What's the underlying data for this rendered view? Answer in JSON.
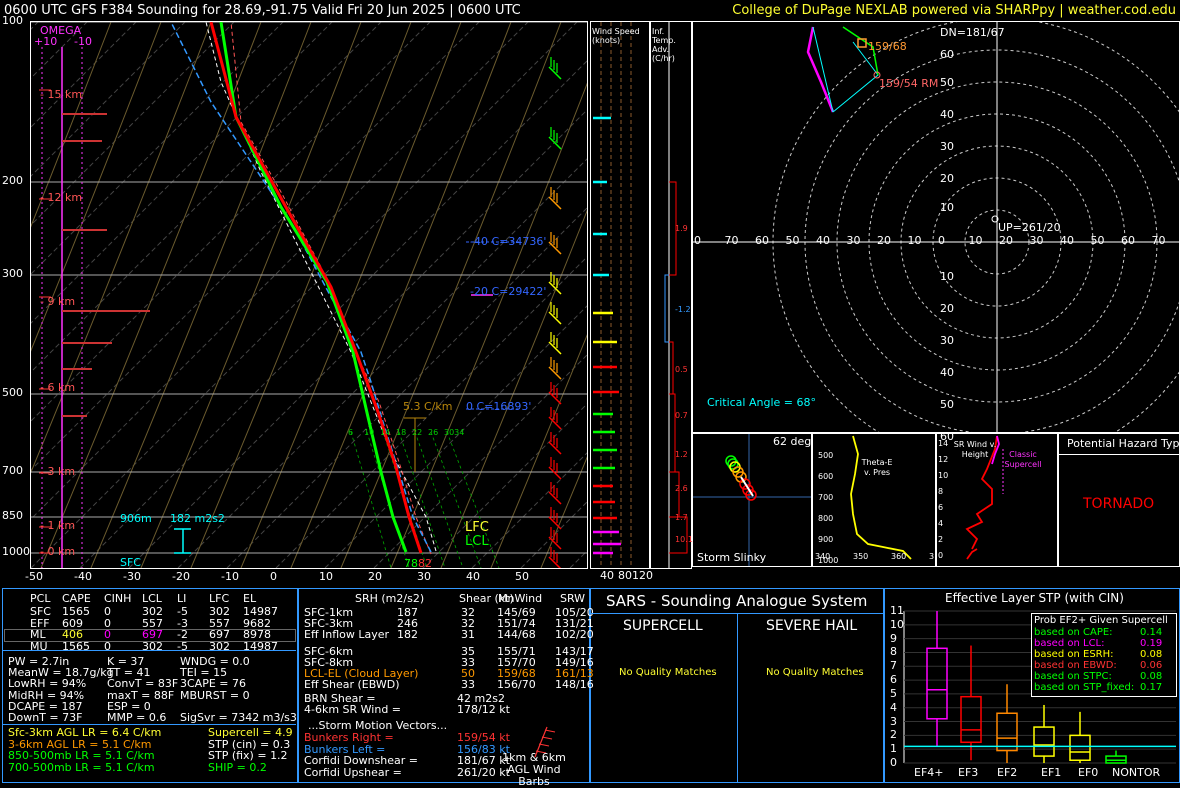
{
  "header": {
    "title": "0600 UTC GFS F384 Sounding for 28.69,-91.75 Valid  Fri 20 Jun 2025 | 0600 UTC",
    "credit": "College of DuPage NEXLAB powered via SHARPpy | weather.cod.edu"
  },
  "skewt": {
    "pressure_labels": [
      "100",
      "200",
      "300",
      "500",
      "700",
      "850",
      "1000"
    ],
    "temp_labels": [
      "-50",
      "-40",
      "-30",
      "-20",
      "-10",
      "0",
      "10",
      "20",
      "30",
      "40",
      "50"
    ],
    "height_labels": [
      "15 km",
      "12 km",
      "9 km",
      "6 km",
      "3 km",
      "1 km",
      "0 km"
    ],
    "omega_label": "OMEGA",
    "omega_ticks": [
      "+10",
      "-10"
    ],
    "annotations": {
      "el": "-40 C=34736'",
      "mpl": "-20 C=29422'",
      "frz": "0 C=16893'",
      "lapse": "5.3 C/km",
      "lfc": "LFC",
      "lcl": "LCL",
      "sfc": "SFC",
      "sfc_height": "906m",
      "srh": "182 m2s2",
      "sfc_temp": "78",
      "sfc_dew": "82",
      "wetbulb_ticks": [
        "6",
        "10",
        "14",
        "18",
        "22",
        "26",
        "3034"
      ]
    },
    "colors": {
      "temp": "#ff0000",
      "dew": "#00cc00",
      "virtual": "#ff0000",
      "wetbulb": "#00ffff",
      "parcel": "#ffffff",
      "isobar": "#aaaaaa",
      "isotherm": "#336699"
    }
  },
  "wind_speed_panel": {
    "title": "Wind Speed (knots)",
    "ticks": [
      "40",
      "80",
      "120"
    ]
  },
  "temp_adv_panel": {
    "title": "Inf. Temp. Adv.(C/hr)",
    "values": [
      "1.9",
      "-1.2",
      "0.5",
      "0.7",
      "1.2",
      "2.6",
      "1.7",
      "10.1"
    ]
  },
  "hodograph": {
    "rings_labels": [
      "60",
      "50",
      "40",
      "30",
      "20",
      "10",
      "0",
      "10",
      "20",
      "30",
      "40",
      "50",
      "60"
    ],
    "x_labels": [
      "0",
      "70",
      "60",
      "50",
      "40",
      "30",
      "20",
      "10",
      "0",
      "10",
      "20",
      "30",
      "40",
      "50",
      "60",
      "70"
    ],
    "dn": "DN=181/67",
    "up": "UP=261/20",
    "lm": "159/68",
    "rm": "159/54 RM",
    "critical_angle": "Critical Angle = 68°"
  },
  "storm_slinky": {
    "label": "Storm Slinky",
    "deg": "62 deg"
  },
  "theta_panel": {
    "label": "Theta-E v. Pres",
    "y_ticks": [
      "500",
      "600",
      "700",
      "800",
      "900",
      "1000"
    ],
    "x_ticks": [
      "340",
      "350",
      "360",
      "3"
    ]
  },
  "srwind_panel": {
    "label": "SR Wind v. Height",
    "y_ticks": [
      "14",
      "12",
      "10",
      "8",
      "6",
      "4",
      "2",
      "0"
    ],
    "classic": "Classic Supercell"
  },
  "hazard": {
    "title": "Potential Hazard Type",
    "value": "TORNADO"
  },
  "parcels": {
    "headers": [
      "PCL",
      "CAPE",
      "CINH",
      "LCL",
      "LI",
      "LFC",
      "EL"
    ],
    "rows": [
      [
        "SFC",
        "1565",
        "0",
        "302",
        "-5",
        "302",
        "14987"
      ],
      [
        "EFF",
        "609",
        "0",
        "557",
        "-3",
        "557",
        "9682"
      ],
      [
        "ML",
        "406",
        "0",
        "697",
        "-2",
        "697",
        "8978"
      ],
      [
        "MU",
        "1565",
        "0",
        "302",
        "-5",
        "302",
        "14987"
      ]
    ]
  },
  "indices": {
    "col1": [
      "PW = 2.7in",
      "MeanW = 18.7g/kg",
      "LowRH = 94%",
      "MidRH = 94%",
      "DCAPE = 187",
      "DownT = 73F"
    ],
    "col2": [
      "K = 37",
      "TT = 41",
      "ConvT = 83F",
      "maxT = 88F",
      "ESP = 0",
      "MMP = 0.6"
    ],
    "col3": [
      "WNDG = 0.0",
      "TEI = 15",
      "3CAPE = 76",
      "MBURST = 0",
      "",
      "SigSvr = 7342 m3/s3"
    ]
  },
  "lapse_rates": [
    "Sfc-3km AGL LR = 6.4 C/km",
    "3-6km AGL LR = 5.1 C/km",
    "850-500mb LR = 5.1 C/km",
    "700-500mb LR = 5.1 C/km"
  ],
  "composite": [
    "Supercell = 4.9",
    "STP (cin) = 0.3",
    "STP (fix) = 1.2",
    "SHIP = 0.2"
  ],
  "kinematics": {
    "headers": [
      "SRH (m2/s2)",
      "Shear (kt)",
      "MnWind",
      "SRW"
    ],
    "rows": [
      [
        "SFC-1km",
        "187",
        "32",
        "145/69",
        "105/20"
      ],
      [
        "SFC-3km",
        "246",
        "32",
        "151/74",
        "131/21"
      ],
      [
        "Eff Inflow Layer",
        "182",
        "31",
        "144/68",
        "102/20"
      ],
      [
        "SFC-6km",
        "",
        "35",
        "155/71",
        "143/17"
      ],
      [
        "SFC-8km",
        "",
        "33",
        "157/70",
        "149/16"
      ],
      [
        "LCL-EL (Cloud Layer)",
        "",
        "50",
        "159/68",
        "161/13"
      ],
      [
        "Eff Shear (EBWD)",
        "",
        "33",
        "156/70",
        "148/16"
      ]
    ],
    "brn_shear": "BRN Shear =",
    "brn_shear_val": "42 m2s2",
    "sr_wind": "4-6km SR Wind =",
    "sr_wind_val": "178/12 kt",
    "storm_motion": "...Storm Motion Vectors...",
    "motions": [
      [
        "Bunkers Right =",
        "159/54 kt"
      ],
      [
        "Bunkers Left =",
        "156/83 kt"
      ],
      [
        "Corfidi Downshear =",
        "181/67 kt"
      ],
      [
        "Corfidi Upshear =",
        "261/20 kt"
      ]
    ],
    "barbs_label": "1km & 6km AGL Wind Barbs"
  },
  "sars": {
    "title": "SARS - Sounding Analogue System",
    "supercell": "SUPERCELL",
    "hail": "SEVERE HAIL",
    "no_match": "No Quality Matches"
  },
  "chart_data": {
    "type": "box",
    "title": "Effective Layer STP (with CIN)",
    "categories": [
      "EF4+",
      "EF3",
      "EF2",
      "EF1",
      "EF0",
      "NONTOR"
    ],
    "y_ticks": [
      "0",
      "1",
      "2",
      "3",
      "4",
      "5",
      "6",
      "7",
      "8",
      "9",
      "10",
      "11"
    ],
    "ylim": [
      0,
      11
    ],
    "boxes": [
      {
        "name": "EF4+",
        "whisker_low": 1.2,
        "q1": 3.2,
        "median": 5.3,
        "q3": 8.3,
        "whisker_high": 11.0,
        "color": "#ff00ff"
      },
      {
        "name": "EF3",
        "whisker_low": 0.2,
        "q1": 1.5,
        "median": 2.4,
        "q3": 4.8,
        "whisker_high": 8.5,
        "color": "#ff0000"
      },
      {
        "name": "EF2",
        "whisker_low": 0.0,
        "q1": 0.9,
        "median": 1.8,
        "q3": 3.6,
        "whisker_high": 5.7,
        "color": "#ff8800"
      },
      {
        "name": "EF1",
        "whisker_low": 0.0,
        "q1": 0.5,
        "median": 1.3,
        "q3": 2.6,
        "whisker_high": 4.2,
        "color": "#ffff00"
      },
      {
        "name": "EF0",
        "whisker_low": 0.0,
        "q1": 0.2,
        "median": 0.8,
        "q3": 2.0,
        "whisker_high": 3.7,
        "color": "#ffff00"
      },
      {
        "name": "NONTOR",
        "whisker_low": 0.0,
        "q1": 0.0,
        "median": 0.2,
        "q3": 0.5,
        "whisker_high": 0.9,
        "color": "#00ff00"
      }
    ],
    "legend_title": "Prob EF2+ Given Supercell",
    "legend": [
      {
        "label": "based on CAPE:",
        "value": "0.14",
        "color": "#00ff00"
      },
      {
        "label": "based on LCL:",
        "value": "0.19",
        "color": "#ff00ff"
      },
      {
        "label": "based on ESRH:",
        "value": "0.08",
        "color": "#ffff00"
      },
      {
        "label": "based on EBWD:",
        "value": "0.06",
        "color": "#ff3333"
      },
      {
        "label": "based on STPC:",
        "value": "0.08",
        "color": "#00ff00"
      },
      {
        "label": "based on STP_fixed:",
        "value": "0.17",
        "color": "#00ff00"
      }
    ]
  }
}
